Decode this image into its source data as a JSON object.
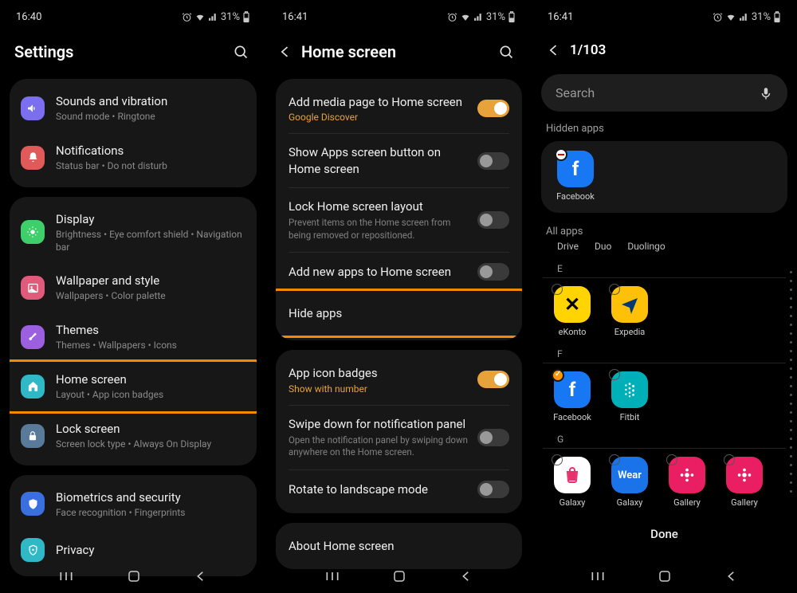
{
  "status": {
    "time1": "16:40",
    "time2": "16:41",
    "time3": "16:41",
    "battery_percent": "31%"
  },
  "screen1": {
    "title": "Settings",
    "items": [
      {
        "title": "Sounds and vibration",
        "sub": "Sound mode  •  Ringtone"
      },
      {
        "title": "Notifications",
        "sub": "Status bar  •  Do not disturb"
      },
      {
        "title": "Display",
        "sub": "Brightness  •  Eye comfort shield  •  Navigation bar"
      },
      {
        "title": "Wallpaper and style",
        "sub": "Wallpapers  •  Color palette"
      },
      {
        "title": "Themes",
        "sub": "Themes  •  Wallpapers  •  Icons"
      },
      {
        "title": "Home screen",
        "sub": "Layout  •  App icon badges"
      },
      {
        "title": "Lock screen",
        "sub": "Screen lock type  •  Always On Display"
      },
      {
        "title": "Biometrics and security",
        "sub": "Face recognition  •  Fingerprints"
      },
      {
        "title": "Privacy",
        "sub": ""
      }
    ]
  },
  "screen2": {
    "title": "Home screen",
    "rows": {
      "media_title": "Add media page to Home screen",
      "media_sub": "Google Discover",
      "apps_button": "Show Apps screen button on Home screen",
      "lock_title": "Lock Home screen layout",
      "lock_sub": "Prevent items on the Home screen from being removed or repositioned.",
      "add_new": "Add new apps to Home screen",
      "hide": "Hide apps",
      "badges_title": "App icon badges",
      "badges_sub": "Show with number",
      "swipe_title": "Swipe down for notification panel",
      "swipe_sub": "Open the notification panel by swiping down anywhere on the Home screen.",
      "rotate": "Rotate to landscape mode",
      "about": "About Home screen"
    }
  },
  "screen3": {
    "counter": "1/103",
    "search_placeholder": "Search",
    "hidden_label": "Hidden apps",
    "hidden_apps": [
      {
        "name": "Facebook"
      }
    ],
    "all_label": "All apps",
    "top_labels": [
      "Drive",
      "Duo",
      "Duolingo"
    ],
    "sections": [
      {
        "letter": "E",
        "apps": [
          "eKonto",
          "Expedia"
        ]
      },
      {
        "letter": "F",
        "apps": [
          "Facebook",
          "Fitbit"
        ]
      },
      {
        "letter": "G",
        "apps": [
          "Galaxy",
          "Galaxy",
          "Gallery",
          "Gallery"
        ]
      }
    ],
    "done": "Done"
  }
}
